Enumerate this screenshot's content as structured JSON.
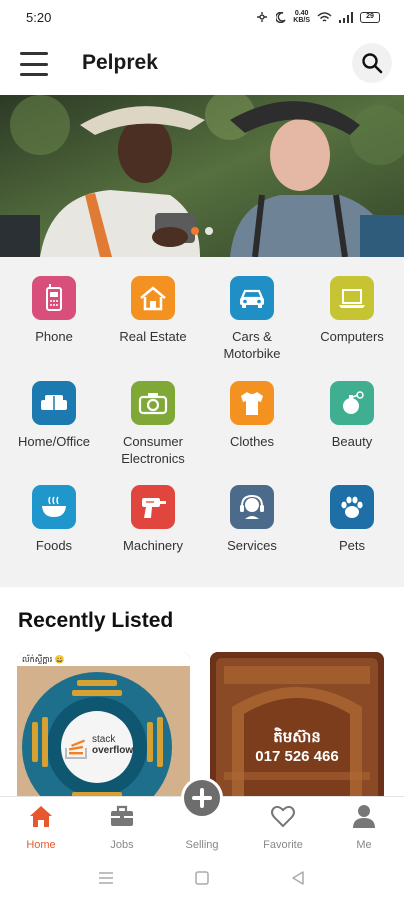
{
  "status_bar": {
    "time": "5:20",
    "net_speed": "0.40\nKB/S",
    "battery": "29"
  },
  "app_bar": {
    "title": "Pelprek"
  },
  "banner": {
    "slide_count": 2,
    "active_slide": 1
  },
  "categories": [
    {
      "label": "Phone",
      "icon": "phone-icon",
      "color": "#d94f7c"
    },
    {
      "label": "Real Estate",
      "icon": "house-icon",
      "color": "#f39221"
    },
    {
      "label": "Cars &\nMotorbike",
      "icon": "car-icon",
      "color": "#1f8fc6"
    },
    {
      "label": "Computers",
      "icon": "laptop-icon",
      "color": "#c6c432"
    },
    {
      "label": "Home/Office",
      "icon": "sofa-icon",
      "color": "#1d7ab0"
    },
    {
      "label": "Consumer\nElectronics",
      "icon": "camera-icon",
      "color": "#7fa837"
    },
    {
      "label": "Clothes",
      "icon": "shirt-icon",
      "color": "#f39221"
    },
    {
      "label": "Beauty",
      "icon": "perfume-icon",
      "color": "#3fae91"
    },
    {
      "label": "Foods",
      "icon": "bowl-icon",
      "color": "#1f96cc"
    },
    {
      "label": "Machinery",
      "icon": "drill-icon",
      "color": "#e0463d"
    },
    {
      "label": "Services",
      "icon": "headset-icon",
      "color": "#4c6b8a"
    },
    {
      "label": "Pets",
      "icon": "paw-icon",
      "color": "#1d6fa5"
    }
  ],
  "recent": {
    "title": "Recently Listed",
    "items": [
      {
        "tag": "ល័ក់ស្ទីក្អ្ការ 😀",
        "logo_line1": "stack",
        "logo_line2": "overflow"
      },
      {
        "line1": "តិមស៊ាន",
        "line2": "017 526 466"
      }
    ]
  },
  "bottom_nav": [
    {
      "label": "Home",
      "icon": "home-icon",
      "active": true
    },
    {
      "label": "Jobs",
      "icon": "briefcase-icon",
      "active": false
    },
    {
      "label": "Selling",
      "icon": "plus-icon",
      "active": false
    },
    {
      "label": "Favorite",
      "icon": "heart-icon",
      "active": false
    },
    {
      "label": "Me",
      "icon": "person-icon",
      "active": false
    }
  ],
  "colors": {
    "accent": "#e8582f",
    "category_bg": "#f2f2f2"
  }
}
